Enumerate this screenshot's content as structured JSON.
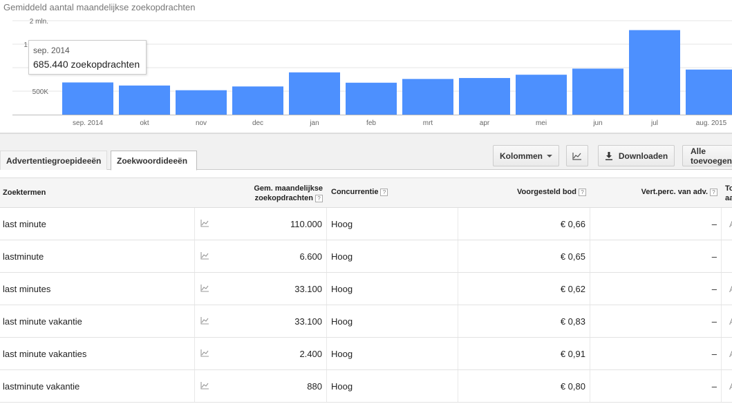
{
  "chart": {
    "title": "Gemiddeld aantal maandelijkse zoekopdrachten",
    "tooltip": {
      "month": "sep. 2014",
      "value_text": "685.440 zoekopdrachten"
    },
    "bar_color": "#4d90fe"
  },
  "chart_data": {
    "type": "bar",
    "title": "Gemiddeld aantal maandelijkse zoekopdrachten",
    "categories": [
      "sep. 2014",
      "okt",
      "nov",
      "dec",
      "jan",
      "feb",
      "mrt",
      "apr",
      "mei",
      "jun",
      "jul",
      "aug. 2015"
    ],
    "values": [
      685440,
      620000,
      520000,
      600000,
      900000,
      680000,
      760000,
      780000,
      850000,
      980000,
      1800000,
      960000
    ],
    "ytick_labels": [
      "2 mln.",
      "1,5 mln.",
      "500K"
    ],
    "yticks": [
      2000000,
      1500000,
      500000
    ],
    "ylim": [
      0,
      2000000
    ],
    "grid": true
  },
  "tabs": {
    "ad_groups": "Advertentiegroepideeën",
    "keywords": "Zoekwoordideeën"
  },
  "toolbar": {
    "columns": "Kolommen",
    "download": "Downloaden",
    "add_all": "Alle toevoegen"
  },
  "table": {
    "headers": {
      "term": "Zoektermen",
      "avg_line1": "Gem. maandelijkse",
      "avg_line2": "zoekopdrachten",
      "competition": "Concurrentie",
      "bid": "Voorgesteld bod",
      "share": "Vert.perc. van adv.",
      "more_line1": "To",
      "more_line2": "aa"
    },
    "help_mark": "?",
    "rows": [
      {
        "term": "last minute",
        "searches": "110.000",
        "competition": "Hoog",
        "bid": "€ 0,66",
        "share": "–",
        "extra": "A"
      },
      {
        "term": "lastminute",
        "searches": "6.600",
        "competition": "Hoog",
        "bid": "€ 0,65",
        "share": "–",
        "extra": ""
      },
      {
        "term": "last minutes",
        "searches": "33.100",
        "competition": "Hoog",
        "bid": "€ 0,62",
        "share": "–",
        "extra": "A"
      },
      {
        "term": "last minute vakantie",
        "searches": "33.100",
        "competition": "Hoog",
        "bid": "€ 0,83",
        "share": "–",
        "extra": "A"
      },
      {
        "term": "last minute vakanties",
        "searches": "2.400",
        "competition": "Hoog",
        "bid": "€ 0,91",
        "share": "–",
        "extra": "A"
      },
      {
        "term": "lastminute vakantie",
        "searches": "880",
        "competition": "Hoog",
        "bid": "€ 0,80",
        "share": "–",
        "extra": "A"
      }
    ]
  }
}
